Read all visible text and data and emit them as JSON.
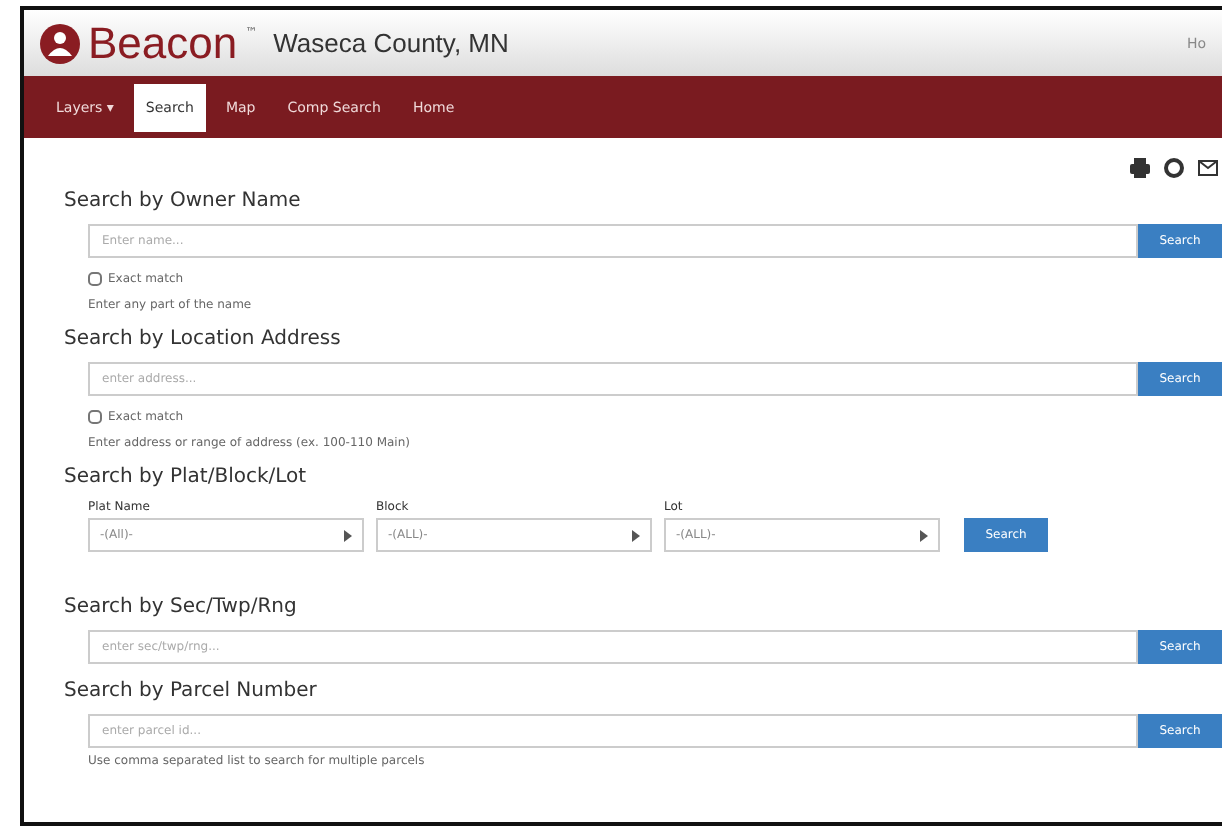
{
  "header": {
    "logo": "Beacon",
    "trademark": "™",
    "county": "Waseca County, MN",
    "corner_link": "Ho"
  },
  "nav": [
    {
      "label": "Layers ▾",
      "selected": false
    },
    {
      "label": "Search",
      "selected": true
    },
    {
      "label": "Map",
      "selected": false
    },
    {
      "label": "Comp Search",
      "selected": false
    },
    {
      "label": "Home",
      "selected": false
    }
  ],
  "sections": [
    {
      "kind": "text",
      "title": "Search by Owner Name",
      "placeholder": "Enter name...",
      "button": "Search",
      "exact_match": {
        "label": "Exact match",
        "checked": false
      },
      "hint": "Enter any part of the name"
    },
    {
      "kind": "text",
      "title": "Search by Location Address",
      "placeholder": "enter address...",
      "button": "Search",
      "exact_match": {
        "label": "Exact match",
        "checked": false
      },
      "hint": "Enter address or range of address (ex. 100-110 Main)"
    },
    {
      "kind": "selects",
      "title": "Search by Plat/Block/Lot",
      "button": "Search",
      "selects": [
        {
          "label": "Plat Name",
          "value": "-(All)-"
        },
        {
          "label": "Block",
          "value": "-(ALL)-"
        },
        {
          "label": "Lot",
          "value": "-(ALL)-"
        }
      ]
    },
    {
      "kind": "text",
      "title": "Search by Sec/Twp/Rng",
      "placeholder": "enter sec/twp/rng...",
      "button": "Search"
    },
    {
      "kind": "text",
      "title": "Search by Parcel Number",
      "placeholder": "enter parcel id...",
      "button": "Search",
      "hint": "Use comma separated list to search for multiple parcels"
    }
  ]
}
